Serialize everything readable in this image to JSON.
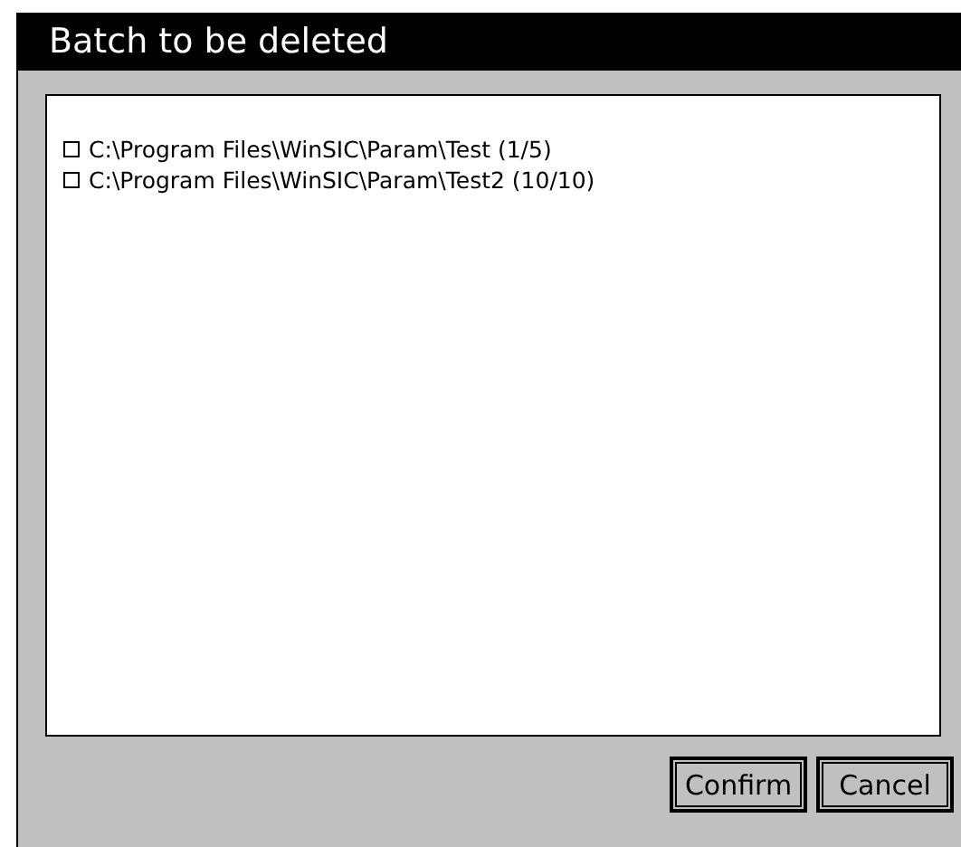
{
  "window": {
    "title": "Batch to be deleted"
  },
  "items": [
    {
      "label": "C:\\Program Files\\WinSIC\\Param\\Test (1/5)",
      "checked": false
    },
    {
      "label": "C:\\Program Files\\WinSIC\\Param\\Test2 (10/10)",
      "checked": false
    }
  ],
  "buttons": [
    "Confirm",
    "Cancel"
  ]
}
